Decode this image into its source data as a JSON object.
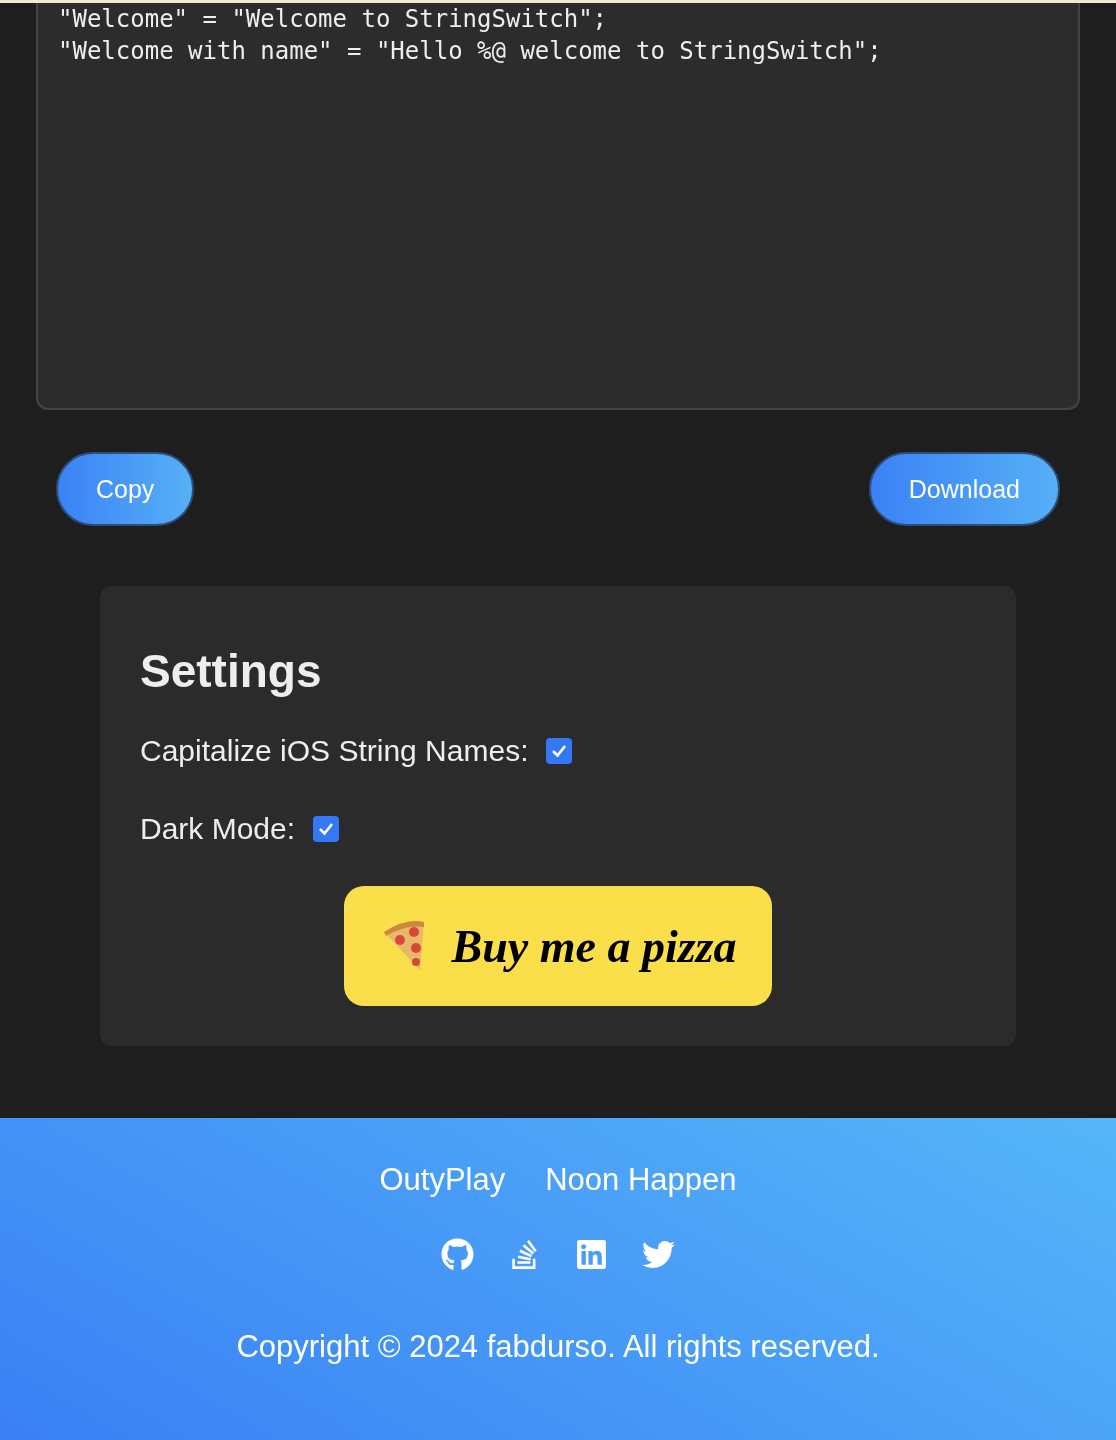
{
  "output": {
    "lines": [
      "\"Welcome\" = \"Welcome to StringSwitch\";",
      "\"Welcome with name\" = \"Hello %@ welcome to StringSwitch\";"
    ]
  },
  "actions": [
    {
      "label": "Copy"
    },
    {
      "label": "Download"
    }
  ],
  "settings": {
    "title": "Settings",
    "options": [
      {
        "label": "Capitalize iOS String Names:",
        "checked": true
      },
      {
        "label": "Dark Mode:",
        "checked": true
      }
    ],
    "donate": {
      "label": "Buy me a pizza"
    }
  },
  "footer": {
    "links": [
      "OutyPlay",
      "Noon Happen"
    ],
    "social": [
      {
        "kind": "github"
      },
      {
        "kind": "stackoverflow"
      },
      {
        "kind": "linkedin"
      },
      {
        "kind": "twitter"
      }
    ],
    "copyright": "Copyright © 2024 fabdurso. All rights reserved."
  }
}
